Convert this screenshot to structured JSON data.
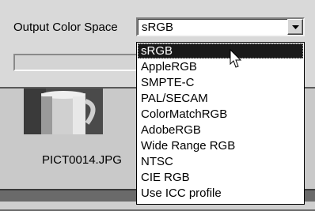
{
  "dialog": {
    "output_label": "Output Color Space",
    "combo_value": "sRGB",
    "filename": "PICT0014.JPG"
  },
  "dropdown": {
    "options": [
      "sRGB",
      "AppleRGB",
      "SMPTE-C",
      "PAL/SECAM",
      "ColorMatchRGB",
      "AdobeRGB",
      "Wide Range RGB",
      "NTSC",
      "CIE RGB",
      "Use ICC profile"
    ],
    "selected_index": 0
  },
  "icons": {
    "combo_arrow": "chevron-down-icon",
    "cursor": "mouse-pointer-icon"
  },
  "colors": {
    "highlight": "#1a1a1a",
    "highlight_text": "#ffffff"
  }
}
